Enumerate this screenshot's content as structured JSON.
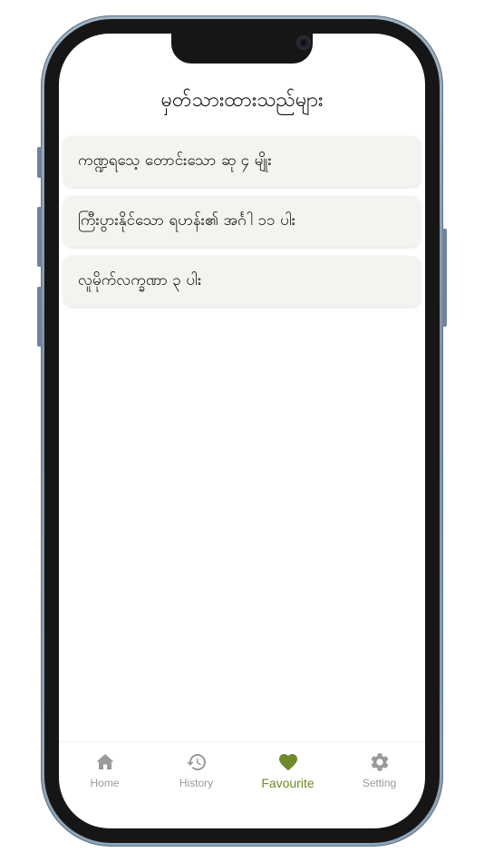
{
  "app": {
    "accent_color": "#6e8a2a",
    "inactive_color": "#9a9a9a"
  },
  "header": {
    "title": "မှတ်သားထားသည်များ"
  },
  "favourites": [
    {
      "title": "ကဏ္ဍရသေ့ တောင်းသော ဆု ၄ မျိုး"
    },
    {
      "title": "ကြီးပွားနိုင်သော ရဟန်း၏ အင်္ဂါ ၁၁ ပါး"
    },
    {
      "title": "လူမိုက်လက္ခဏာ ၃ ပါး"
    }
  ],
  "bottom_nav": {
    "items": [
      {
        "label": "Home",
        "icon": "home-icon",
        "active": false
      },
      {
        "label": "History",
        "icon": "history-icon",
        "active": false
      },
      {
        "label": "Favourite",
        "icon": "heart-icon",
        "active": true
      },
      {
        "label": "Setting",
        "icon": "gear-icon",
        "active": false
      }
    ]
  }
}
